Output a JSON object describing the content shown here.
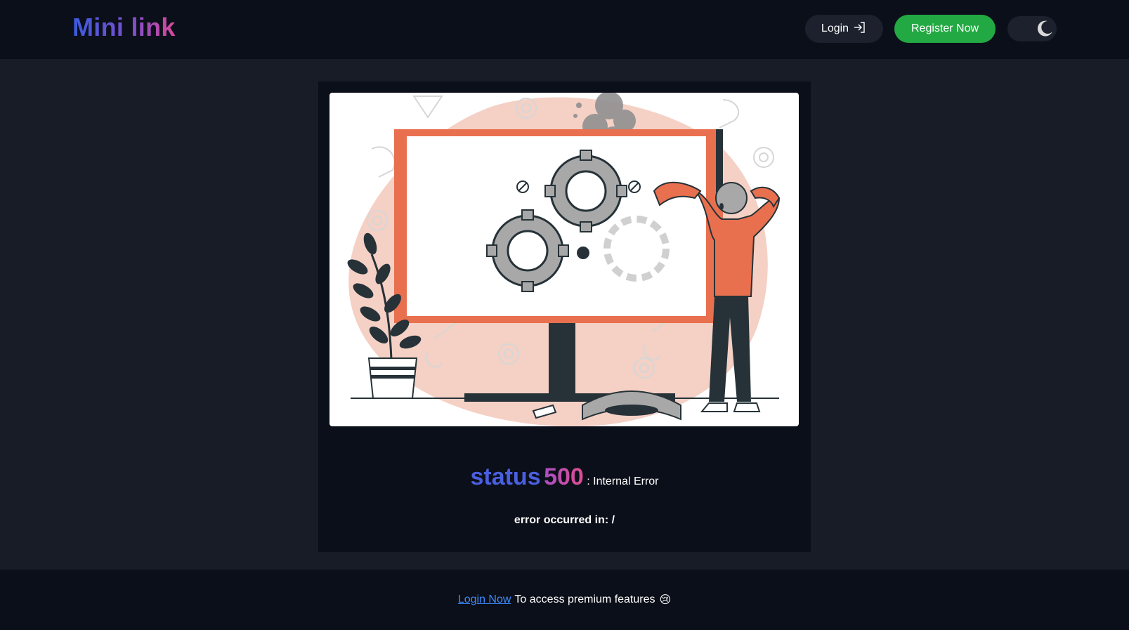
{
  "header": {
    "logo": "Mini link",
    "login_label": "Login",
    "register_label": "Register Now"
  },
  "error": {
    "status_word": "status",
    "status_code": "500",
    "status_text": ": Internal Error",
    "location": "error occurred in: /"
  },
  "footer": {
    "link_label": "Login Now",
    "message": "To access premium features",
    "emoji": "😢"
  },
  "colors": {
    "header_bg": "#0b0f19",
    "page_bg": "#171c27",
    "register_green": "#23a943",
    "accent_orange": "#e8704f",
    "link_blue": "#3d8bfd"
  }
}
